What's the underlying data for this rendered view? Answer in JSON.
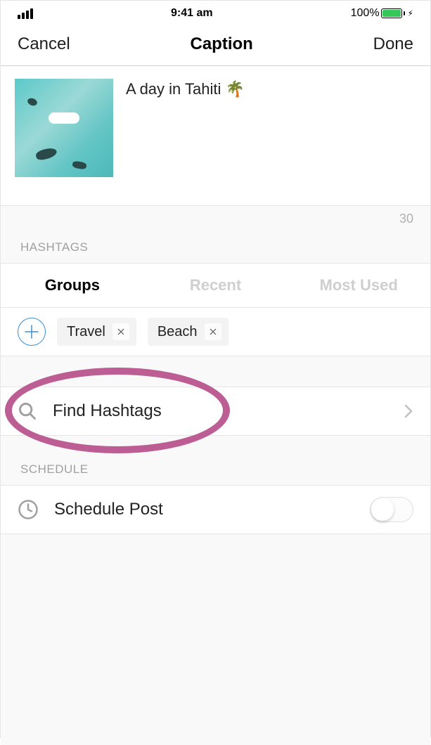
{
  "status": {
    "time": "9:41 am",
    "battery": "100%"
  },
  "nav": {
    "cancel": "Cancel",
    "title": "Caption",
    "done": "Done"
  },
  "caption": {
    "text": "A day in Tahiti 🌴",
    "count": "30"
  },
  "hashtags": {
    "label": "HASHTAGS",
    "tabs": {
      "groups": "Groups",
      "recent": "Recent",
      "most_used": "Most Used"
    },
    "tags": [
      {
        "name": "Travel"
      },
      {
        "name": "Beach"
      }
    ],
    "find": "Find Hashtags"
  },
  "schedule": {
    "label": "SCHEDULE",
    "text": "Schedule Post"
  }
}
